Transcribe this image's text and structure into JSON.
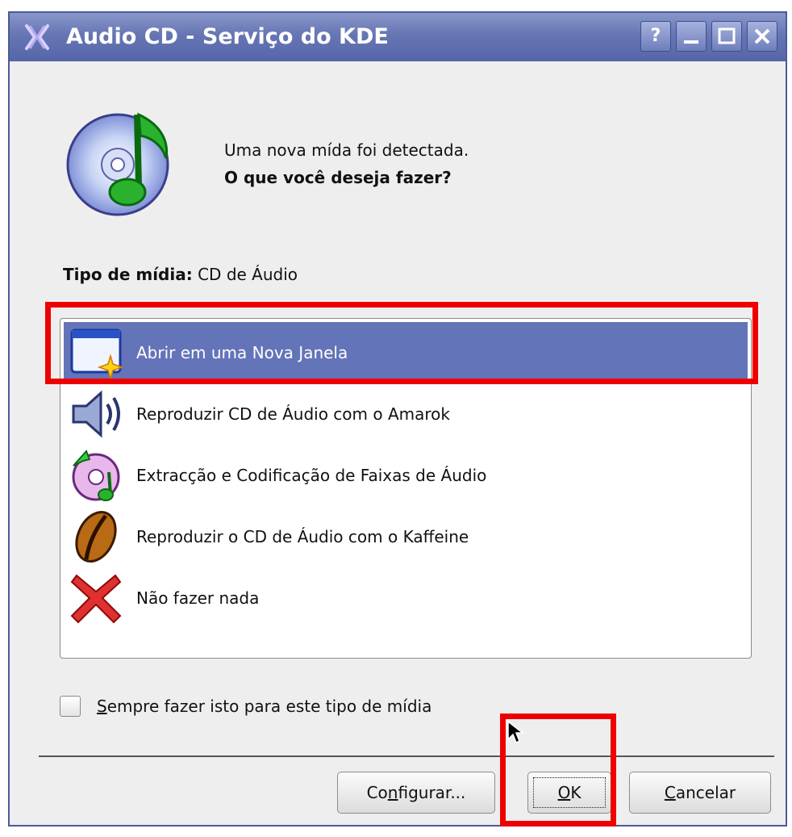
{
  "window": {
    "title": "Audio CD - Serviço do KDE",
    "buttons": {
      "help": "?"
    }
  },
  "message": {
    "line1": "Uma nova mída foi detectada.",
    "line2": "O que você deseja fazer?"
  },
  "media_type": {
    "label": "Tipo de mídia:",
    "value": "CD de Áudio"
  },
  "actions": [
    {
      "label": "Abrir em uma Nova Janela",
      "icon": "new-window-icon",
      "selected": true
    },
    {
      "label": "Reproduzir CD de Áudio com o Amarok",
      "icon": "speaker-icon",
      "selected": false
    },
    {
      "label": "Extracção e Codificação de Faixas de Áudio",
      "icon": "cd-rip-icon",
      "selected": false
    },
    {
      "label": "Reproduzir o CD de Áudio com o Kaffeine",
      "icon": "kaffeine-bean-icon",
      "selected": false
    },
    {
      "label": "Não fazer nada",
      "icon": "red-x-icon",
      "selected": false
    }
  ],
  "always_checkbox": {
    "mnemonic": "S",
    "rest": "empre fazer isto para este tipo de mídia",
    "checked": false
  },
  "buttons": {
    "configure": {
      "pre": "Co",
      "mnemonic": "n",
      "post": "figurar..."
    },
    "ok": {
      "mnemonic": "O",
      "post": "K"
    },
    "cancel": {
      "mnemonic": "C",
      "post": "ancelar"
    }
  },
  "colors": {
    "titlebar": "#6676b4",
    "selection": "#6474b8",
    "highlight_box": "#ee0000",
    "dialog_bg": "#eeeeee"
  }
}
